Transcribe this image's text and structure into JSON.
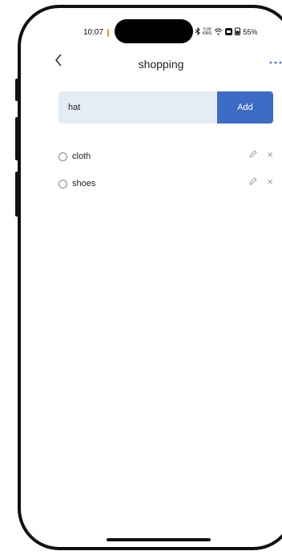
{
  "status_bar": {
    "time": "10:07",
    "net_speed_value": "5.00",
    "net_speed_unit": "KB/S",
    "battery": "55%"
  },
  "nav": {
    "title": "shopping",
    "back_icon": "chevron-left-icon",
    "more_icon": "more-dots-icon"
  },
  "input": {
    "value": "hat",
    "add_label": "Add"
  },
  "items": [
    {
      "label": "cloth"
    },
    {
      "label": "shoes"
    }
  ],
  "colors": {
    "accent": "#3c6cc4",
    "input_bg": "#e6ecf6"
  }
}
